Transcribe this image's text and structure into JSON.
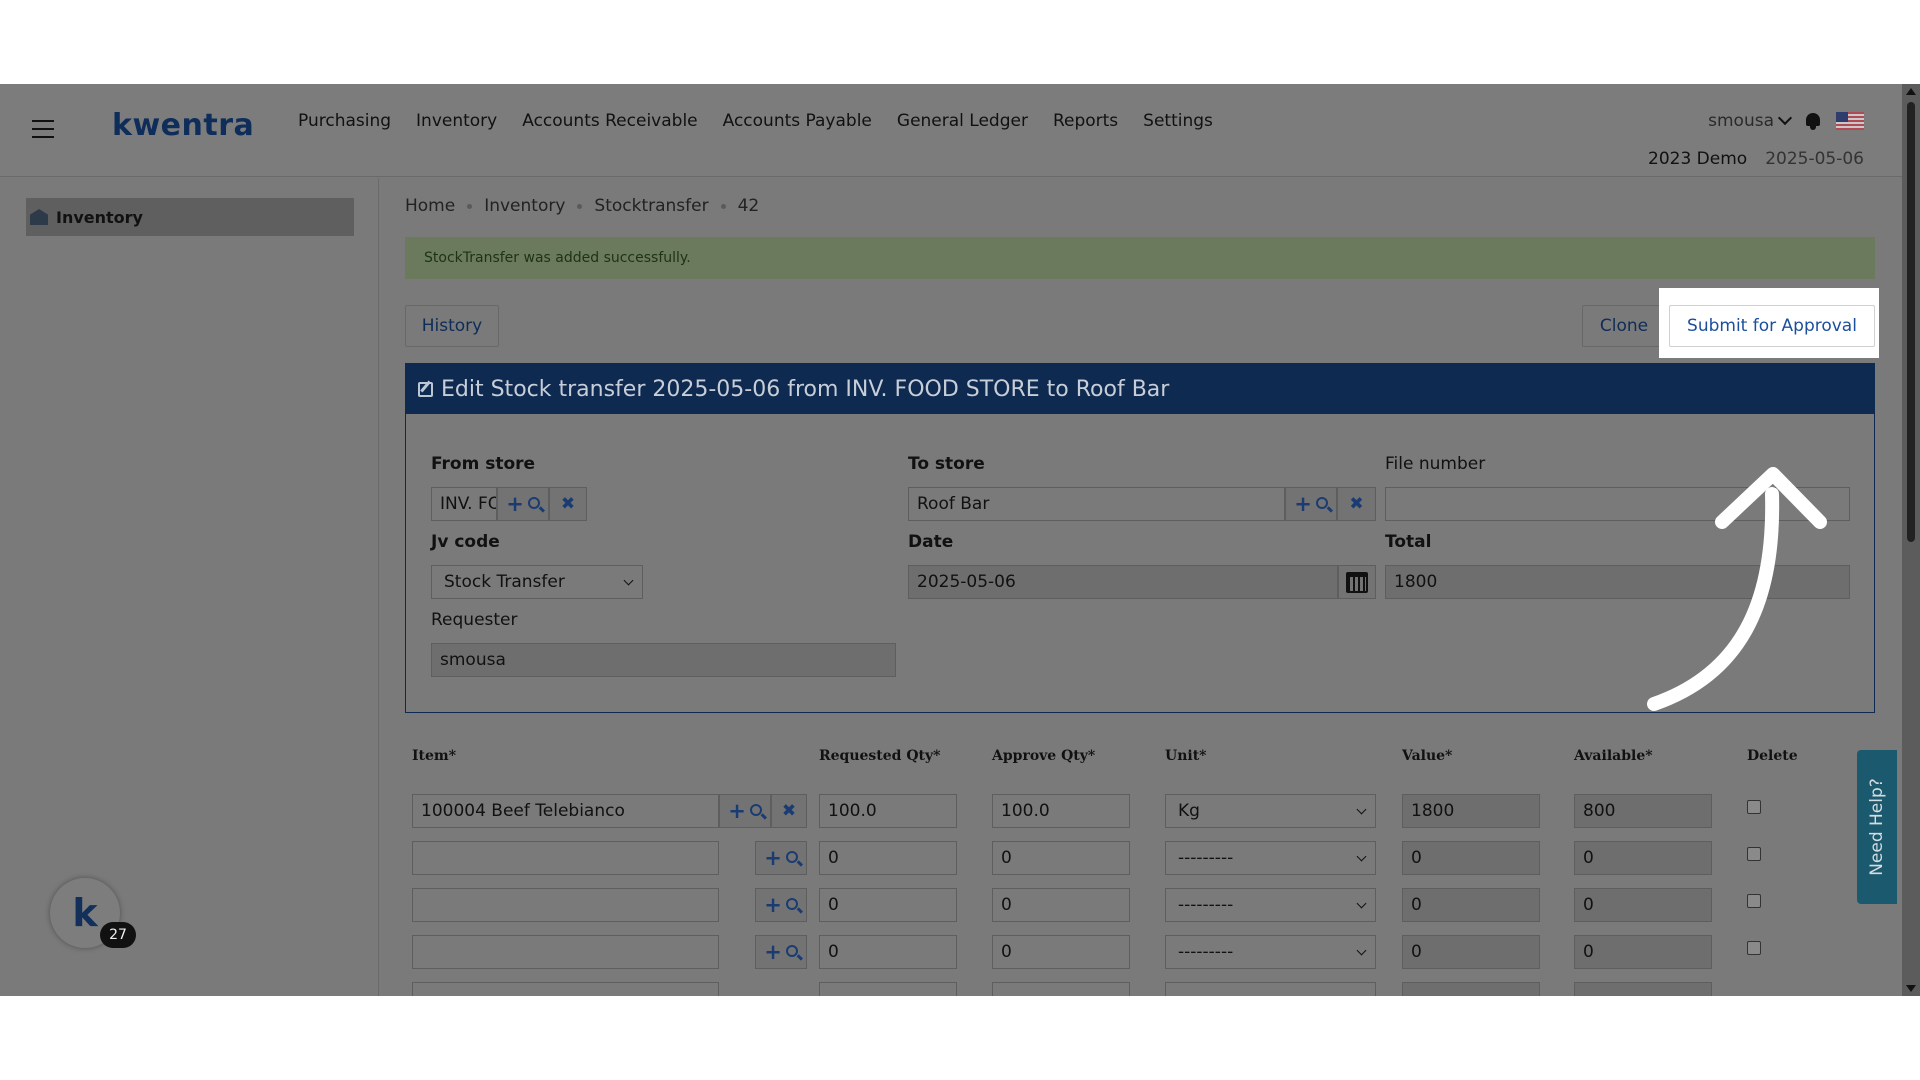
{
  "app": {
    "logo": "kwentra",
    "nav": [
      "Purchasing",
      "Inventory",
      "Accounts Receivable",
      "Accounts Payable",
      "General Ledger",
      "Reports",
      "Settings"
    ],
    "user": "smousa",
    "company": "2023 Demo",
    "date": "2025-05-06"
  },
  "sidebar": {
    "items": [
      {
        "label": "Inventory",
        "icon": "warehouse-icon"
      }
    ]
  },
  "breadcrumb": [
    "Home",
    "Inventory",
    "Stocktransfer",
    "42"
  ],
  "alert": "StockTransfer was added successfully.",
  "buttons": {
    "history": "History",
    "clone": "Clone",
    "submit": "Submit for Approval"
  },
  "form": {
    "title": "Edit Stock transfer 2025-05-06 from INV. FOOD STORE to Roof Bar",
    "from_store_label": "From store",
    "from_store_value": "INV. FOOD STORE",
    "to_store_label": "To store",
    "to_store_value": "Roof Bar",
    "file_number_label": "File number",
    "file_number_value": "",
    "jv_code_label": "Jv code",
    "jv_code_value": "Stock Transfer",
    "date_label": "Date",
    "date_value": "2025-05-06",
    "total_label": "Total",
    "total_value": "1800",
    "requester_label": "Requester",
    "requester_value": "smousa"
  },
  "items_table": {
    "columns": [
      "Item*",
      "Requested Qty*",
      "Approve Qty*",
      "Unit*",
      "Value*",
      "Available*",
      "Delete"
    ],
    "rows": [
      {
        "item": "100004 Beef Telebianco",
        "requested": "100.0",
        "approve": "100.0",
        "unit": "Kg",
        "value": "1800",
        "available": "800"
      },
      {
        "item": "",
        "requested": "0",
        "approve": "0",
        "unit": "---------",
        "value": "0",
        "available": "0"
      },
      {
        "item": "",
        "requested": "0",
        "approve": "0",
        "unit": "---------",
        "value": "0",
        "available": "0"
      },
      {
        "item": "",
        "requested": "0",
        "approve": "0",
        "unit": "---------",
        "value": "0",
        "available": "0"
      }
    ]
  },
  "help_tab": "Need Help?",
  "chat_badge": "27",
  "colors": {
    "overlay_bg": "#7a7a7a",
    "header_navy": "#0e2a50",
    "submit_text": "#1b4f9e",
    "annotation_arrow": "#ffffff"
  }
}
